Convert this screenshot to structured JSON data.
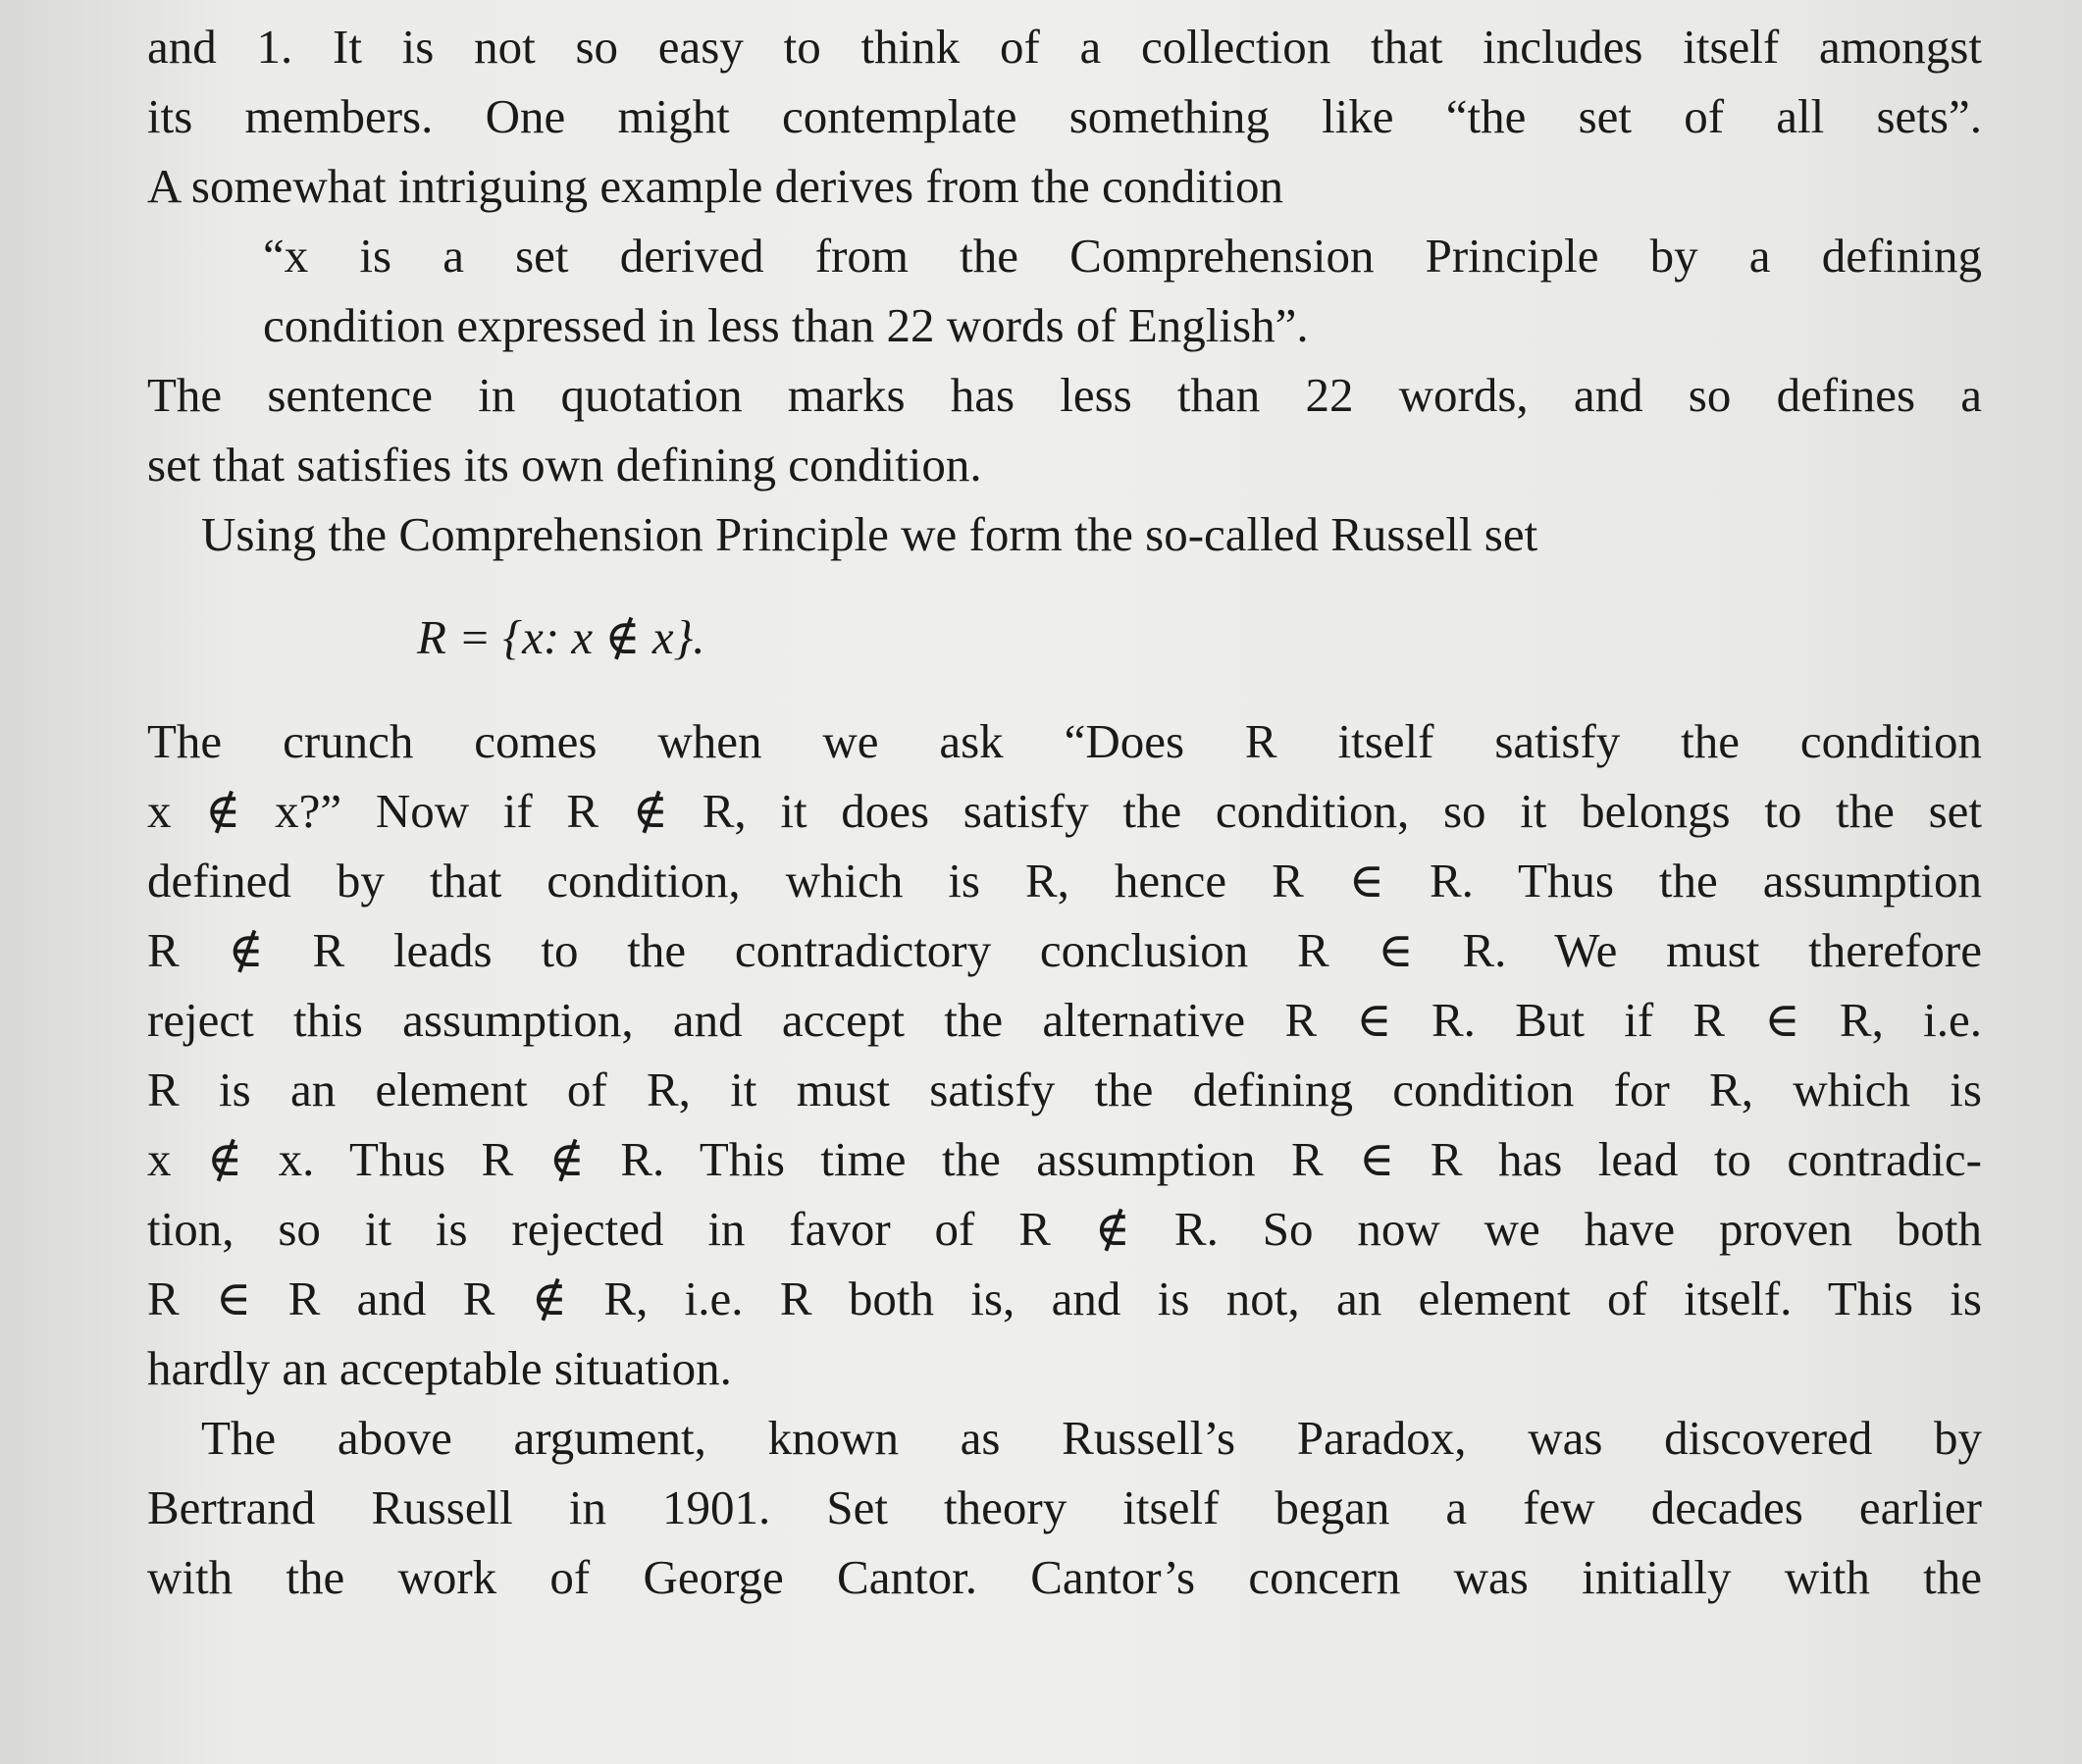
{
  "paragraphs": [
    {
      "id": "p1",
      "lines": [
        "and 1. It is not so easy to think of a collection that includes itself amongst",
        "its members. One might contemplate something like “the set of all sets”.",
        "A somewhat intriguing example derives from the condition"
      ]
    },
    {
      "id": "quote",
      "lines": [
        "“x is a set derived from the Comprehension Principle by a defining",
        "condition expressed in less than 22 words of English”."
      ]
    },
    {
      "id": "p2",
      "lines": [
        "The sentence in quotation marks has less than 22 words, and so defines a",
        "set that satisfies its own defining condition."
      ]
    },
    {
      "id": "p3",
      "lines": [
        "Using the Comprehension Principle we form the so-called Russell set"
      ]
    },
    {
      "id": "display",
      "lines": [
        "R = {x: x ∉ x}."
      ]
    },
    {
      "id": "p4",
      "lines": [
        "The crunch comes when we ask “Does R itself satisfy the condition",
        "x ∉ x?” Now if R ∉ R, it does satisfy the condition, so it belongs to the set",
        "defined by that condition, which is R, hence R ∈ R. Thus the assumption",
        "R ∉ R leads to the contradictory conclusion R ∈ R. We must therefore",
        "reject this assumption, and accept the alternative R ∈ R. But if R ∈ R, i.e.",
        "R is an element of R, it must satisfy the defining condition for R, which is",
        "x ∉ x. Thus R ∉ R. This time the assumption R ∈ R has lead to contradic-",
        "tion, so it is rejected in favor of R ∉ R. So now we have proven both",
        "R ∈ R and R ∉ R, i.e. R both is, and is not, an element of itself. This is",
        "hardly an acceptable situation."
      ]
    },
    {
      "id": "p5",
      "lines": [
        "The above argument, known as Russell’s Paradox, was discovered by",
        "Bertrand Russell in 1901. Set theory itself began a few decades earlier",
        "with the work of George Cantor. Cantor’s concern was initially with the"
      ]
    }
  ]
}
